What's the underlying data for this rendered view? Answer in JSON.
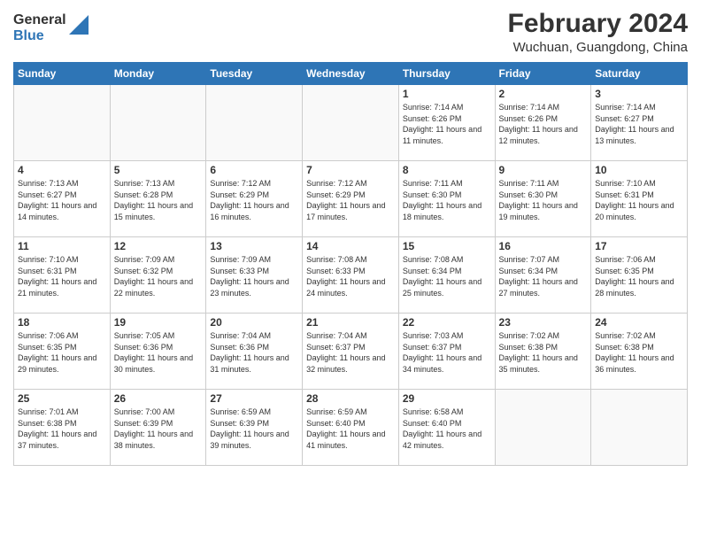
{
  "header": {
    "logo_general": "General",
    "logo_blue": "Blue",
    "month_title": "February 2024",
    "location": "Wuchuan, Guangdong, China"
  },
  "days_of_week": [
    "Sunday",
    "Monday",
    "Tuesday",
    "Wednesday",
    "Thursday",
    "Friday",
    "Saturday"
  ],
  "weeks": [
    [
      {
        "day": "",
        "info": ""
      },
      {
        "day": "",
        "info": ""
      },
      {
        "day": "",
        "info": ""
      },
      {
        "day": "",
        "info": ""
      },
      {
        "day": "1",
        "info": "Sunrise: 7:14 AM\nSunset: 6:26 PM\nDaylight: 11 hours and 11 minutes."
      },
      {
        "day": "2",
        "info": "Sunrise: 7:14 AM\nSunset: 6:26 PM\nDaylight: 11 hours and 12 minutes."
      },
      {
        "day": "3",
        "info": "Sunrise: 7:14 AM\nSunset: 6:27 PM\nDaylight: 11 hours and 13 minutes."
      }
    ],
    [
      {
        "day": "4",
        "info": "Sunrise: 7:13 AM\nSunset: 6:27 PM\nDaylight: 11 hours and 14 minutes."
      },
      {
        "day": "5",
        "info": "Sunrise: 7:13 AM\nSunset: 6:28 PM\nDaylight: 11 hours and 15 minutes."
      },
      {
        "day": "6",
        "info": "Sunrise: 7:12 AM\nSunset: 6:29 PM\nDaylight: 11 hours and 16 minutes."
      },
      {
        "day": "7",
        "info": "Sunrise: 7:12 AM\nSunset: 6:29 PM\nDaylight: 11 hours and 17 minutes."
      },
      {
        "day": "8",
        "info": "Sunrise: 7:11 AM\nSunset: 6:30 PM\nDaylight: 11 hours and 18 minutes."
      },
      {
        "day": "9",
        "info": "Sunrise: 7:11 AM\nSunset: 6:30 PM\nDaylight: 11 hours and 19 minutes."
      },
      {
        "day": "10",
        "info": "Sunrise: 7:10 AM\nSunset: 6:31 PM\nDaylight: 11 hours and 20 minutes."
      }
    ],
    [
      {
        "day": "11",
        "info": "Sunrise: 7:10 AM\nSunset: 6:31 PM\nDaylight: 11 hours and 21 minutes."
      },
      {
        "day": "12",
        "info": "Sunrise: 7:09 AM\nSunset: 6:32 PM\nDaylight: 11 hours and 22 minutes."
      },
      {
        "day": "13",
        "info": "Sunrise: 7:09 AM\nSunset: 6:33 PM\nDaylight: 11 hours and 23 minutes."
      },
      {
        "day": "14",
        "info": "Sunrise: 7:08 AM\nSunset: 6:33 PM\nDaylight: 11 hours and 24 minutes."
      },
      {
        "day": "15",
        "info": "Sunrise: 7:08 AM\nSunset: 6:34 PM\nDaylight: 11 hours and 25 minutes."
      },
      {
        "day": "16",
        "info": "Sunrise: 7:07 AM\nSunset: 6:34 PM\nDaylight: 11 hours and 27 minutes."
      },
      {
        "day": "17",
        "info": "Sunrise: 7:06 AM\nSunset: 6:35 PM\nDaylight: 11 hours and 28 minutes."
      }
    ],
    [
      {
        "day": "18",
        "info": "Sunrise: 7:06 AM\nSunset: 6:35 PM\nDaylight: 11 hours and 29 minutes."
      },
      {
        "day": "19",
        "info": "Sunrise: 7:05 AM\nSunset: 6:36 PM\nDaylight: 11 hours and 30 minutes."
      },
      {
        "day": "20",
        "info": "Sunrise: 7:04 AM\nSunset: 6:36 PM\nDaylight: 11 hours and 31 minutes."
      },
      {
        "day": "21",
        "info": "Sunrise: 7:04 AM\nSunset: 6:37 PM\nDaylight: 11 hours and 32 minutes."
      },
      {
        "day": "22",
        "info": "Sunrise: 7:03 AM\nSunset: 6:37 PM\nDaylight: 11 hours and 34 minutes."
      },
      {
        "day": "23",
        "info": "Sunrise: 7:02 AM\nSunset: 6:38 PM\nDaylight: 11 hours and 35 minutes."
      },
      {
        "day": "24",
        "info": "Sunrise: 7:02 AM\nSunset: 6:38 PM\nDaylight: 11 hours and 36 minutes."
      }
    ],
    [
      {
        "day": "25",
        "info": "Sunrise: 7:01 AM\nSunset: 6:38 PM\nDaylight: 11 hours and 37 minutes."
      },
      {
        "day": "26",
        "info": "Sunrise: 7:00 AM\nSunset: 6:39 PM\nDaylight: 11 hours and 38 minutes."
      },
      {
        "day": "27",
        "info": "Sunrise: 6:59 AM\nSunset: 6:39 PM\nDaylight: 11 hours and 39 minutes."
      },
      {
        "day": "28",
        "info": "Sunrise: 6:59 AM\nSunset: 6:40 PM\nDaylight: 11 hours and 41 minutes."
      },
      {
        "day": "29",
        "info": "Sunrise: 6:58 AM\nSunset: 6:40 PM\nDaylight: 11 hours and 42 minutes."
      },
      {
        "day": "",
        "info": ""
      },
      {
        "day": "",
        "info": ""
      }
    ]
  ]
}
